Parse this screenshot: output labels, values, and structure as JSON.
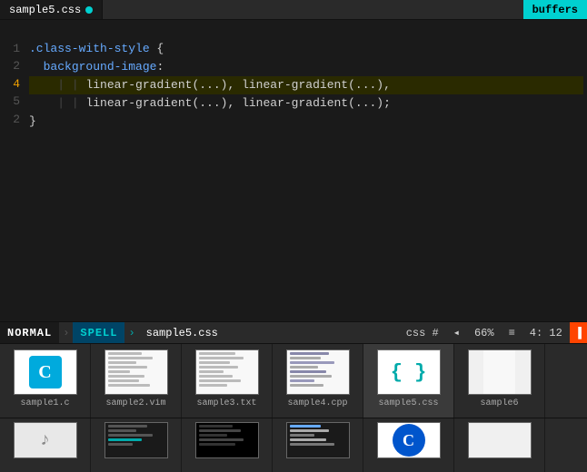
{
  "tab": {
    "filename": "sample5.css",
    "dot": true
  },
  "buffers_label": "buffers",
  "editor": {
    "lines": [
      {
        "num": "",
        "content": "",
        "active": false,
        "parts": []
      },
      {
        "num": "1",
        "content": ".class-with-style {",
        "active": false
      },
      {
        "num": "2",
        "content": "  background-image:",
        "active": false
      },
      {
        "num": "4",
        "content": "    | | linear-gradient(...), linear-gradient(...),",
        "active": true
      },
      {
        "num": "5",
        "content": "    | | linear-gradient(...), linear-gradient(...);",
        "active": false
      },
      {
        "num": "2",
        "content": "}",
        "active": false
      }
    ]
  },
  "status": {
    "mode": "NORMAL",
    "spell": "SPELL",
    "filename": "sample5.css",
    "type": "css",
    "hash": "#",
    "percent": "66%",
    "equals": "≡",
    "position": "4: 12"
  },
  "thumbnails": [
    {
      "name": "sample1.c",
      "type": "c-icon"
    },
    {
      "name": "sample2.vim",
      "type": "text"
    },
    {
      "name": "sample3.txt",
      "type": "text"
    },
    {
      "name": "sample4.cpp",
      "type": "text-small"
    },
    {
      "name": "sample5.css",
      "type": "brackets",
      "active": true
    },
    {
      "name": "sample6",
      "type": "partial"
    }
  ],
  "thumbnails2": [
    {
      "name": "",
      "type": "music"
    },
    {
      "name": "",
      "type": "dark"
    },
    {
      "name": "",
      "type": "dark"
    },
    {
      "name": "",
      "type": "dark"
    },
    {
      "name": "",
      "type": "blue-c"
    },
    {
      "name": "",
      "type": "partial2"
    }
  ]
}
